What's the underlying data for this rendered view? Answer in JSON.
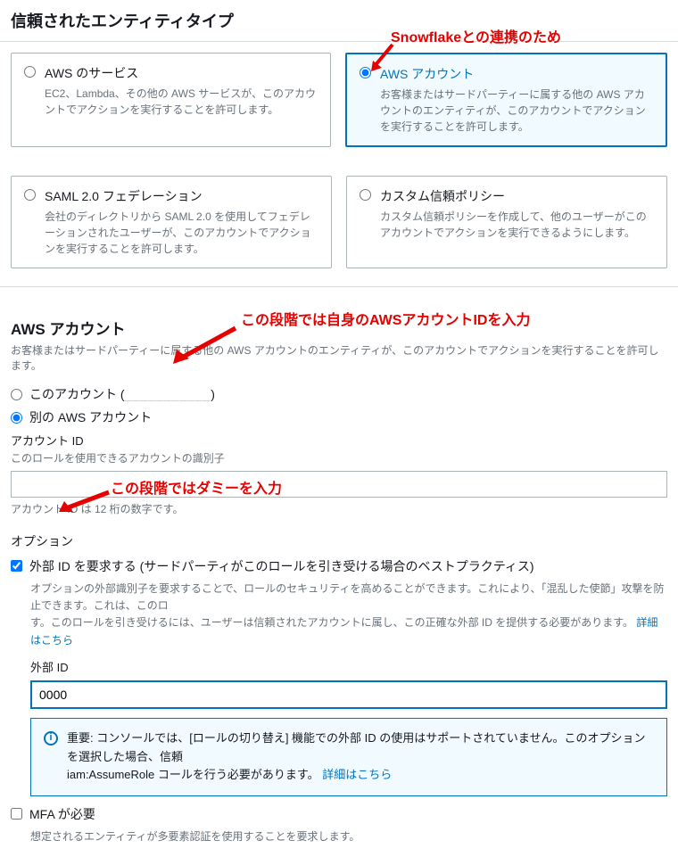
{
  "header": {
    "title": "信頼されたエンティティタイプ"
  },
  "annotations": {
    "a1": "Snowflakeとの連携のため",
    "a2": "この段階では自身のAWSアカウントIDを入力",
    "a3": "この段階ではダミーを入力"
  },
  "cards": {
    "aws_service": {
      "title": "AWS のサービス",
      "desc": "EC2、Lambda、その他の AWS サービスが、このアカウントでアクションを実行することを許可します。"
    },
    "aws_account": {
      "title": "AWS アカウント",
      "desc": "お客様またはサードパーティーに属する他の AWS アカウントのエンティティが、このアカウントでアクションを実行することを許可します。"
    },
    "saml": {
      "title": "SAML 2.0 フェデレーション",
      "desc": "会社のディレクトリから SAML 2.0 を使用してフェデレーションされたユーザーが、このアカウントでアクションを実行することを許可します。"
    },
    "custom": {
      "title": "カスタム信頼ポリシー",
      "desc": "カスタム信頼ポリシーを作成して、他のユーザーがこのアカウントでアクションを実行できるようにします。"
    }
  },
  "account_section": {
    "title": "AWS アカウント",
    "desc": "お客様またはサードパーティーに属する他の AWS アカウントのエンティティが、このアカウントでアクションを実行することを許可します。",
    "this_account_label": "このアカウント (",
    "this_account_masked": "___________",
    "this_account_close": ")",
    "other_account_label": "別の AWS アカウント",
    "account_id_label": "アカウント ID",
    "account_id_help": "このロールを使用できるアカウントの識別子",
    "account_id_value": "",
    "account_id_hint": "アカウント ID は 12 桁の数字です。"
  },
  "options": {
    "title": "オプション",
    "ext_id_label": "外部 ID を要求する (サードパーティがこのロールを引き受ける場合のベストプラクティス)",
    "ext_id_desc_1": "オプションの外部識別子を要求することで、ロールのセキュリティを高めることができます。これにより、「混乱した使節」攻撃を防止できます。これは、このロ",
    "ext_id_desc_2": "す。このロールを引き受けるには、ユーザーは信頼されたアカウントに属し、この正確な外部 ID を提供する必要があります。 ",
    "ext_id_link": "詳細はこちら",
    "ext_id_field_label": "外部 ID",
    "ext_id_value": "0000",
    "info_text_1": "重要: コンソールでは、[ロールの切り替え] 機能での外部 ID の使用はサポートされていません。このオプションを選択した場合、信頼",
    "info_text_2": "iam:AssumeRole コールを行う必要があります。 ",
    "info_link": "詳細はこちら",
    "mfa_label": "MFA が必要",
    "mfa_desc": "想定されるエンティティが多要素認証を使用することを要求します。"
  }
}
